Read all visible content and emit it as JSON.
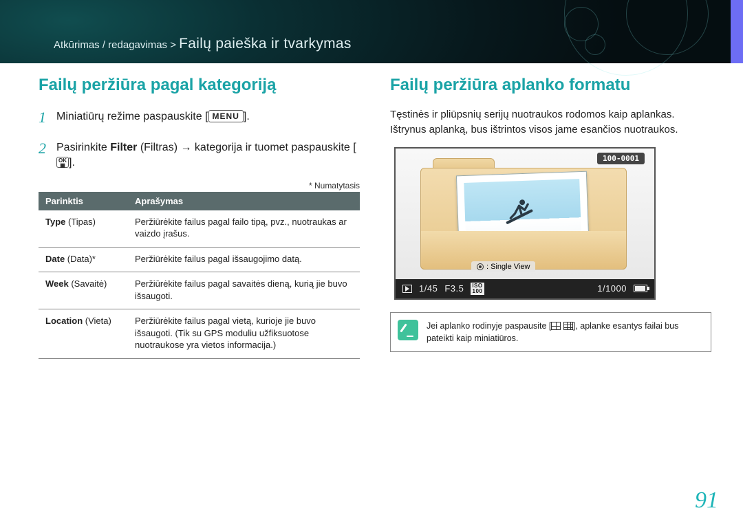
{
  "header": {
    "breadcrumb_prefix": "Atkūrimas / redagavimas >",
    "breadcrumb_title": "Failų paieška ir tvarkymas"
  },
  "left": {
    "title": "Failų peržiūra pagal kategoriją",
    "step1_pre": "Miniatiūrų režime paspauskite [",
    "step1_button": "MENU",
    "step1_post": "].",
    "step2_pre": "Pasirinkite ",
    "step2_bold": "Filter",
    "step2_mid": " (Filtras) → kategorija ir tuomet paspauskite [",
    "step2_post": "].",
    "ok_top": "OK",
    "ok_bot": "▦",
    "default_note": "* Numatytasis",
    "th_option": "Parinktis",
    "th_desc": "Aprašymas",
    "rows": [
      {
        "label_b": "Type",
        "label_p": " (Tipas)",
        "desc": "Peržiūrėkite failus pagal failo tipą, pvz., nuotraukas ar vaizdo įrašus."
      },
      {
        "label_b": "Date",
        "label_p": " (Data)*",
        "desc": "Peržiūrėkite failus pagal išsaugojimo datą."
      },
      {
        "label_b": "Week",
        "label_p": " (Savaitė)",
        "desc": "Peržiūrėkite failus pagal savaitės dieną, kurią jie buvo išsaugoti."
      },
      {
        "label_b": "Location",
        "label_p": " (Vieta)",
        "desc": "Peržiūrėkite failus pagal vietą, kurioje jie buvo išsaugoti. (Tik su GPS moduliu užfiksuotose nuotraukose yra vietos informacija.)"
      }
    ]
  },
  "right": {
    "title": "Failų peržiūra aplanko formatu",
    "intro": "Tęstinės ir pliūpsnių serijų nuotraukos rodomos kaip aplankas. Ištrynus aplanką, bus ištrintos visos jame esančios nuotraukos.",
    "folder_id": "100-0001",
    "single_view": ": Single View",
    "status": {
      "counter": "1/45",
      "fstop": "F3.5",
      "iso_label": "ISO",
      "iso_val": "100",
      "shutter": "1/1000"
    },
    "tip_pre": "Jei aplanko rodinyje paspausite [",
    "tip_post": "], aplanke esantys failai bus pateikti kaip miniatiūros."
  },
  "page_number": "91"
}
